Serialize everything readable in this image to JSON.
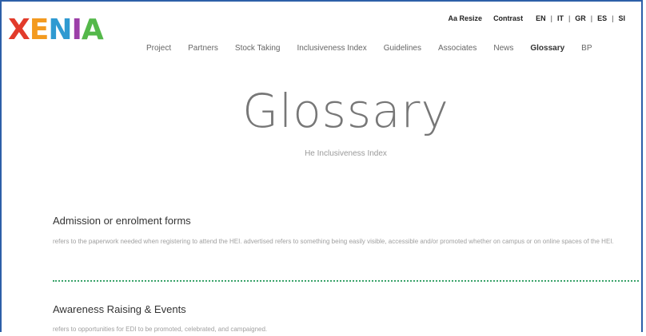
{
  "logo": {
    "letters": [
      {
        "char": "X",
        "color": "#e23b2b"
      },
      {
        "char": "E",
        "color": "#f39a1f"
      },
      {
        "char": "N",
        "color": "#2f9ad1"
      },
      {
        "char": "I",
        "color": "#9c3fa8"
      },
      {
        "char": "A",
        "color": "#54b84a"
      }
    ]
  },
  "toolbar": {
    "resize_label": "Aa Resize",
    "contrast_label": "Contrast",
    "languages": [
      "EN",
      "IT",
      "GR",
      "ES",
      "SI"
    ],
    "separator": "|"
  },
  "nav": {
    "items": [
      {
        "label": "Project"
      },
      {
        "label": "Partners"
      },
      {
        "label": "Stock Taking"
      },
      {
        "label": "Inclusiveness Index"
      },
      {
        "label": "Guidelines"
      },
      {
        "label": "Associates"
      },
      {
        "label": "News"
      },
      {
        "label": "Glossary",
        "active": true
      },
      {
        "label": "BP"
      }
    ]
  },
  "page": {
    "title": "Glossary",
    "subtitle": "He Inclusiveness Index"
  },
  "entries": [
    {
      "title": "Admission or enrolment forms",
      "text": "refers to the paperwork needed when registering to attend the HEI. advertised refers to something being easily visible, accessible and/or promoted whether on campus or on online spaces of the HEI."
    },
    {
      "title": "Awareness Raising & Events",
      "text": "refers to opportunities for EDI to be promoted, celebrated, and campaigned."
    }
  ],
  "colors": {
    "frame": "#2d5fa8",
    "divider": "#3aa36a"
  }
}
